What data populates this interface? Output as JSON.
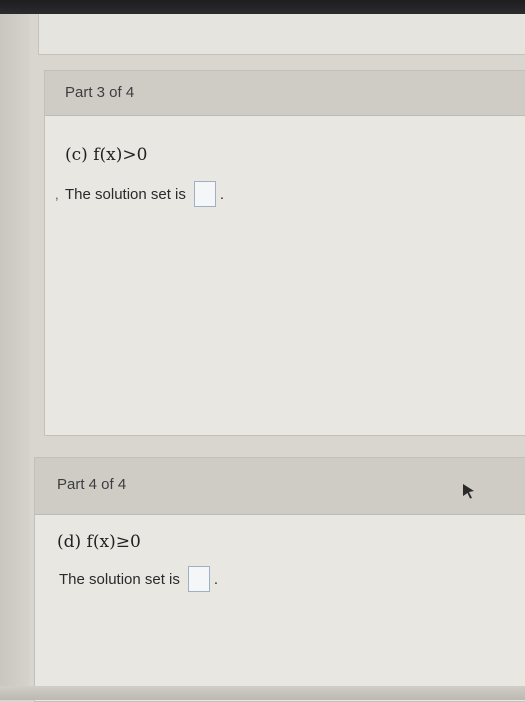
{
  "part3": {
    "header": "Part 3 of 4",
    "question": "(c) f(x)>0",
    "answer_prefix": "The solution set is",
    "answer_suffix": "."
  },
  "part4": {
    "header": "Part 4 of 4",
    "question": "(d) f(x)≥0",
    "answer_prefix": "The solution set is",
    "answer_suffix": "."
  },
  "icons": {
    "cursor": "mouse-pointer-icon"
  }
}
